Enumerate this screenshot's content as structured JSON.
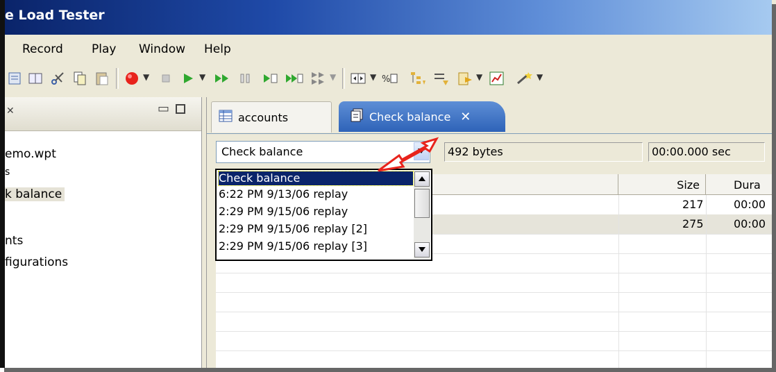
{
  "window": {
    "title": "e Load Tester"
  },
  "menu": [
    "Record",
    "Play",
    "Window",
    "Help"
  ],
  "left_panel": {
    "items": [
      "emo.wpt",
      "s",
      "k balance",
      "nts",
      "figurations"
    ]
  },
  "editor_tabs": [
    {
      "label": "accounts",
      "active": false
    },
    {
      "label": "Check balance",
      "active": true
    }
  ],
  "transaction": {
    "selected": "Check balance",
    "size_text": "492 bytes",
    "duration_text": "00:00.000 sec"
  },
  "dropdown_options": [
    "Check balance",
    "6:22 PM 9/13/06 replay",
    "2:29 PM 9/15/06 replay",
    "2:29 PM 9/15/06 replay [2]",
    "2:29 PM 9/15/06 replay [3]"
  ],
  "table": {
    "headers": {
      "size": "Size",
      "duration": "Dura"
    },
    "rows": [
      {
        "size": "217",
        "duration": "00:00"
      },
      {
        "size": "275",
        "duration": "00:00"
      }
    ]
  },
  "colors": {
    "selection": "#0a246a",
    "annotation_arrow": "#e8231c",
    "record_button": "#e8231c",
    "play_button": "#2fa82f"
  }
}
